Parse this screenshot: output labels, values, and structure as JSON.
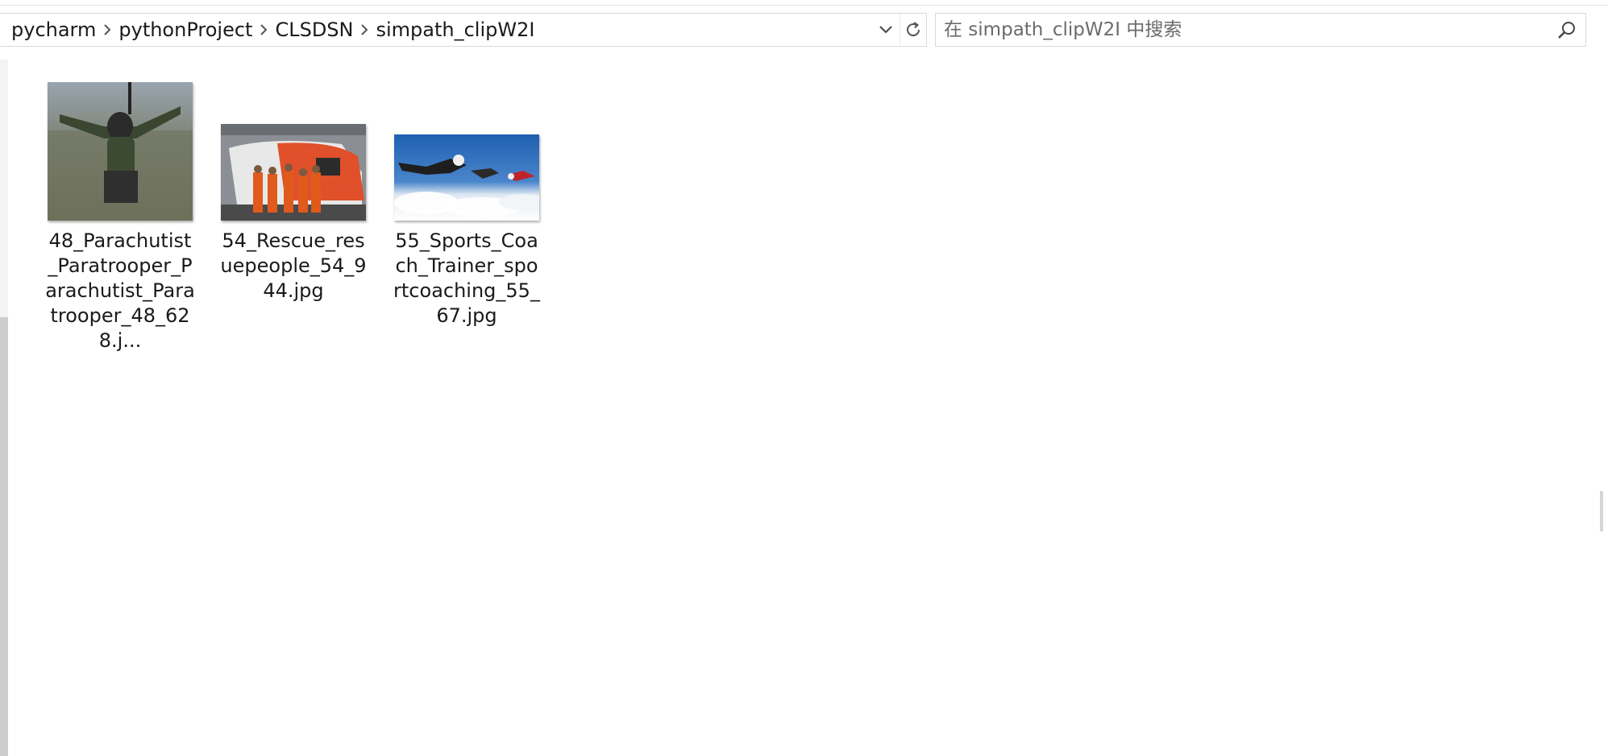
{
  "breadcrumb": {
    "items": [
      "pycharm",
      "pythonProject",
      "CLSDSN",
      "simpath_clipW2I"
    ]
  },
  "search": {
    "placeholder": "在 simpath_clipW2I 中搜索"
  },
  "icons": {
    "separator": "chevron-right-icon",
    "dropdown": "chevron-down-icon",
    "refresh": "refresh-icon",
    "search": "search-icon"
  },
  "files": [
    {
      "name": "48_Parachutist_Paratrooper_Parachutist_Paratrooper_48_628.j...",
      "thumbnail": "parachutist-photo"
    },
    {
      "name": "54_Rescue_resuepeople_54_944.jpg",
      "thumbnail": "rescue-helicopter-photo"
    },
    {
      "name": "55_Sports_Coach_Trainer_sportcoaching_55_67.jpg",
      "thumbnail": "skydivers-photo"
    }
  ]
}
